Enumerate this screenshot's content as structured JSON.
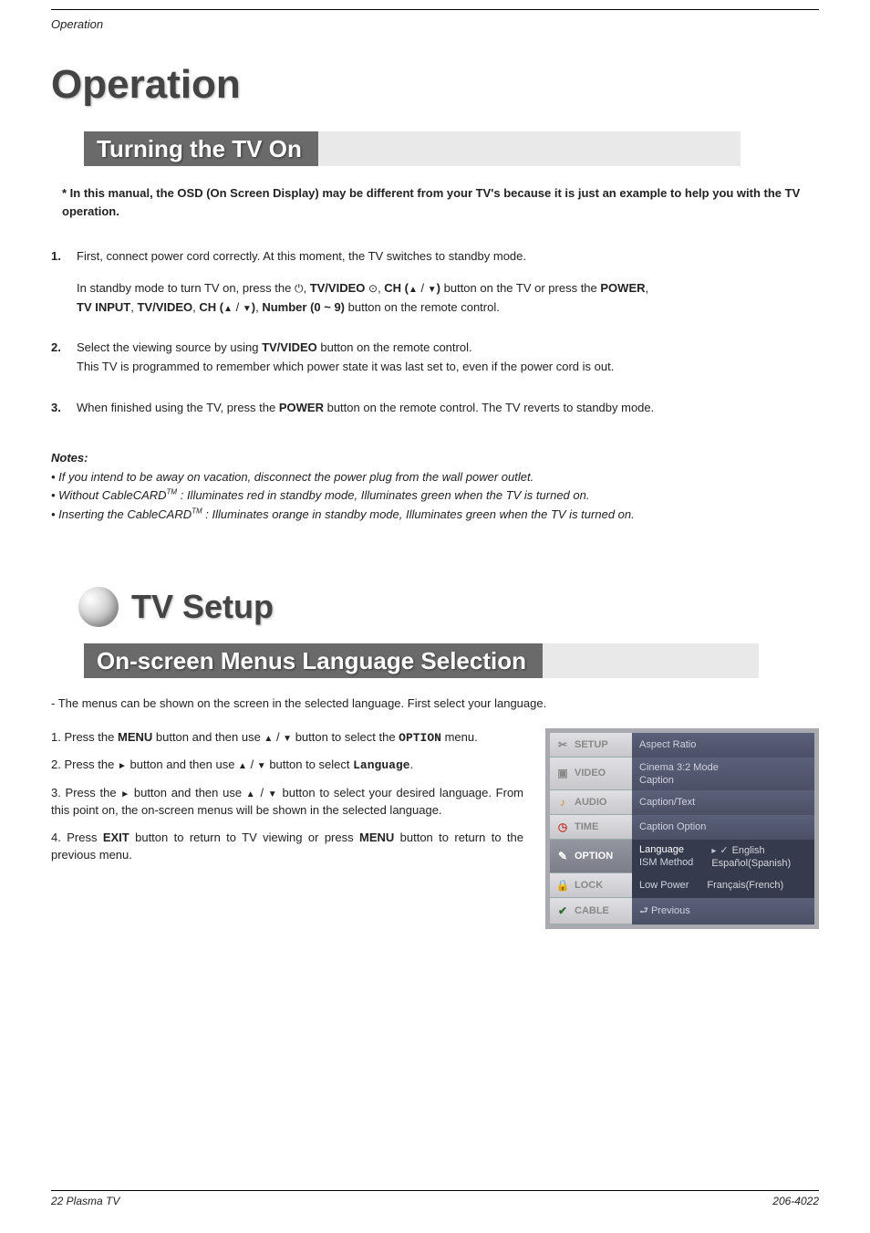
{
  "header": {
    "section": "Operation"
  },
  "h1": "Operation",
  "bar1": "Turning the TV On",
  "intro": "* In this manual, the OSD (On Screen Display) may be different from your TV's because it is just an example to help you with the TV operation.",
  "steps_a": {
    "s1": {
      "num": "1.",
      "line1": "First, connect power cord correctly. At this moment, the TV switches to standby mode.",
      "line2a": "In standby mode to turn TV on, press the ",
      "line2b": ", ",
      "tvvideo": "TV/VIDEO",
      "line2c": " ",
      "line2d": ", ",
      "chlabel": "CH (",
      "slash": " / ",
      "chclose": ")",
      "line2e": " button on the TV or press the ",
      "power": "POWER",
      "line2f": ",",
      "line3a": "",
      "tvinput": "TV INPUT",
      "comma": ", ",
      "numlabel": "Number (0 ~ 9)",
      "line3b": " button on the remote control."
    },
    "s2": {
      "num": "2.",
      "line1": "Select the viewing source by using ",
      "tvvideo": "TV/VIDEO",
      "line1b": " button on the remote control.",
      "line2": "This TV is programmed to remember which power state it was last set to, even if the power cord is out."
    },
    "s3": {
      "num": "3.",
      "line1a": "When finished using the TV, press the ",
      "power": "POWER",
      "line1b": " button on the remote control. The TV reverts to standby mode."
    }
  },
  "notes": {
    "heading": "Notes:",
    "n1": "• If you intend to be away on vacation, disconnect the power plug from the wall power outlet.",
    "n2a": "• Without CableCARD",
    "n2b": " : Illuminates red in standby mode, Illuminates green when the TV is turned on.",
    "n3a": "• Inserting the CableCARD",
    "n3b": " : Illuminates orange in standby mode, Illuminates green when the TV is turned on.",
    "tm": "TM"
  },
  "h2": "TV Setup",
  "bar2": "On-screen Menus Language Selection",
  "sub_note_prefix": "- ",
  "sub_note": "The menus can be shown on the screen in the selected language. First select your language.",
  "steps_b": {
    "s1a": "1. Press the ",
    "menu": "MENU",
    "s1b": " button and then use ",
    "s1c": " / ",
    "s1d": " button to select the ",
    "option": "OPTION",
    "s1e": " menu.",
    "s2a": "2. Press the ",
    "s2b": " button and then use ",
    "s2c": " / ",
    "s2d": " button to select ",
    "language": "Language",
    "s2e": ".",
    "s3a": "3. Press the ",
    "s3b": " button and then use ",
    "s3c": " / ",
    "s3d": " button to select your desired language. From this point on, the on-screen menus will be shown in the selected language.",
    "s4a": "4. Press ",
    "exit": "EXIT",
    "s4b": " button to return to TV viewing or press ",
    "s4c": " button to return to the previous menu."
  },
  "osd": {
    "tabs": {
      "setup": "SETUP",
      "video": "VIDEO",
      "audio": "AUDIO",
      "time": "TIME",
      "option": "OPTION",
      "lock": "LOCK",
      "cable": "CABLE"
    },
    "lines": {
      "aspect": "Aspect Ratio",
      "cinema": "Cinema 3:2 Mode",
      "caption": "Caption",
      "captiontext": "Caption/Text",
      "captionoption": "Caption Option",
      "language": "Language",
      "ism": "ISM Method",
      "lowpower": "Low Power",
      "previous": "Previous"
    },
    "langs": {
      "english": "English",
      "spanish": "Español(Spanish)",
      "french": "Français(French)"
    },
    "icons": {
      "setup": "✂",
      "video": "▣",
      "audio": "♪",
      "time": "◷",
      "option": "✎",
      "lock": "🔒",
      "cable": "✔",
      "arrow": "⮐"
    }
  },
  "footer": {
    "left": "22   Plasma TV",
    "right": "206-4022"
  }
}
